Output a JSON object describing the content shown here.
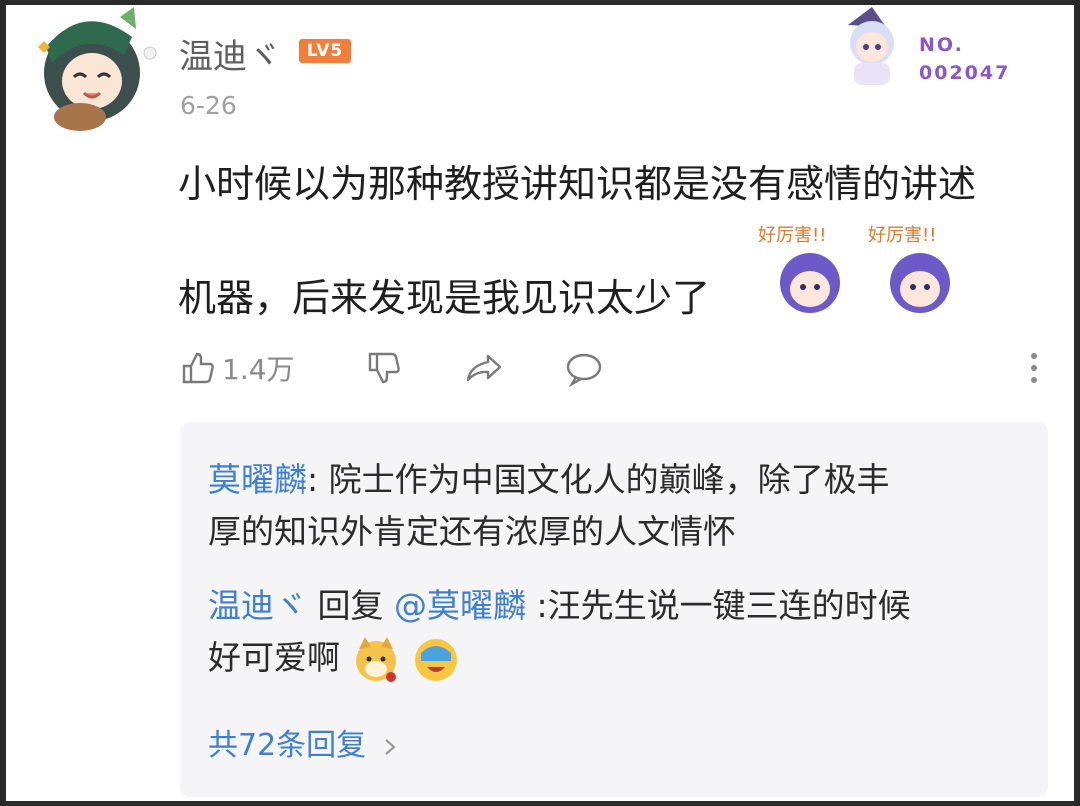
{
  "user": {
    "name": "温迪ヾ",
    "level": "LV5",
    "date": "6-26"
  },
  "badge": {
    "no_label": "NO.",
    "no_value": "002047"
  },
  "comment": {
    "line1": "小时候以为那种教授讲知识都是没有感情的讲述",
    "line2": "机器，后来发现是我见识太少了",
    "sticker_text": "好厉害!!"
  },
  "actions": {
    "like_count": "1.4万"
  },
  "replies": [
    {
      "author": "莫曜麟",
      "text_line1": ": 院士作为中国文化人的巅峰，除了极丰",
      "text_line2": "厚的知识外肯定还有浓厚的人文情怀"
    },
    {
      "author": "温迪ヾ",
      "reply_word": " 回复 ",
      "mention": "@莫曜麟",
      "text_line1": " :汪先生说一键三连的时候",
      "text_line2": "好可爱啊"
    }
  ],
  "more_replies": "共72条回复",
  "colors": {
    "accent": "#3f7fd0",
    "level": "#f27e3a",
    "badge": "#8c56c9"
  },
  "icons": [
    "like-icon",
    "dislike-icon",
    "share-icon",
    "comment-icon",
    "more-vertical-icon",
    "chevron-right-icon"
  ]
}
